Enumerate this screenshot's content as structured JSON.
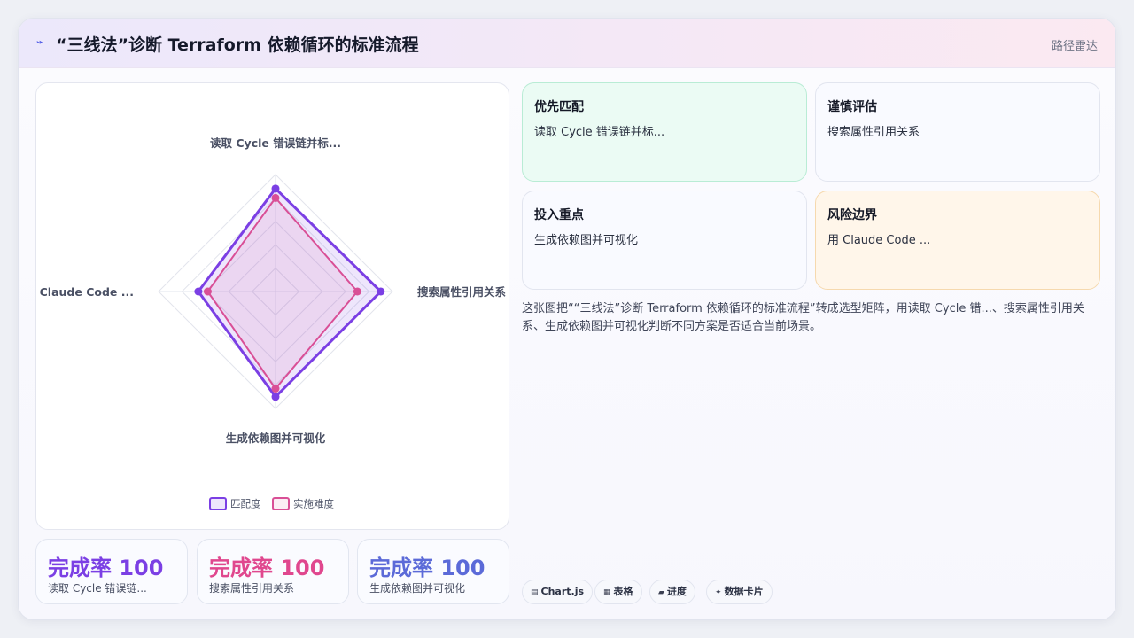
{
  "header": {
    "title_icon": "lightning-icon",
    "title": "“三线法”诊断 Terraform 依赖循环的标准流程",
    "subtitle": "路径雷达"
  },
  "chart_data": {
    "type": "radar",
    "axes": [
      "读取 Cycle 错误链并标...",
      "搜索属性引用关系",
      "生成依赖图并可视化",
      "用 Claude Code ..."
    ],
    "rmax": 100,
    "rings": 5,
    "series": [
      {
        "name": "匹配度",
        "values": [
          88,
          90,
          90,
          66
        ],
        "color": "#7b3fe4",
        "fill": "rgba(123,63,228,0.13)"
      },
      {
        "name": "实施难度",
        "values": [
          80,
          70,
          83,
          58
        ],
        "color": "#d94f96",
        "fill": "rgba(217,79,150,0.10)"
      }
    ],
    "legend_position": "bottom"
  },
  "stats": [
    {
      "label": "完成率",
      "value": "100",
      "desc": "读取 Cycle 错误链...",
      "color": "#7b3fe4"
    },
    {
      "label": "完成率",
      "value": "100",
      "desc": "搜索属性引用关系",
      "color": "#e0478e"
    },
    {
      "label": "完成率",
      "value": "100",
      "desc": "生成依赖图并可视化",
      "color": "#5b6ad8"
    }
  ],
  "cards": [
    {
      "title": "优先匹配",
      "desc": "读取 Cycle 错误链并标..."
    },
    {
      "title": "谨慎评估",
      "desc": "搜索属性引用关系"
    },
    {
      "title": "投入重点",
      "desc": "生成依赖图并可视化"
    },
    {
      "title": "风险边界",
      "desc": "用 Claude Code ..."
    }
  ],
  "summary": "这张图把““三线法”诊断 Terraform 依赖循环的标准流程”转成选型矩阵，用读取 Cycle 错...、搜索属性引用关系、生成依赖图并可视化判断不同方案是否适合当前场景。",
  "chips": [
    {
      "icon": "▤",
      "label": "Chart.js"
    },
    {
      "icon": "▦",
      "label": "表格"
    },
    {
      "icon": "▰",
      "label": "进度"
    },
    {
      "icon": "✦",
      "label": "数据卡片"
    }
  ]
}
